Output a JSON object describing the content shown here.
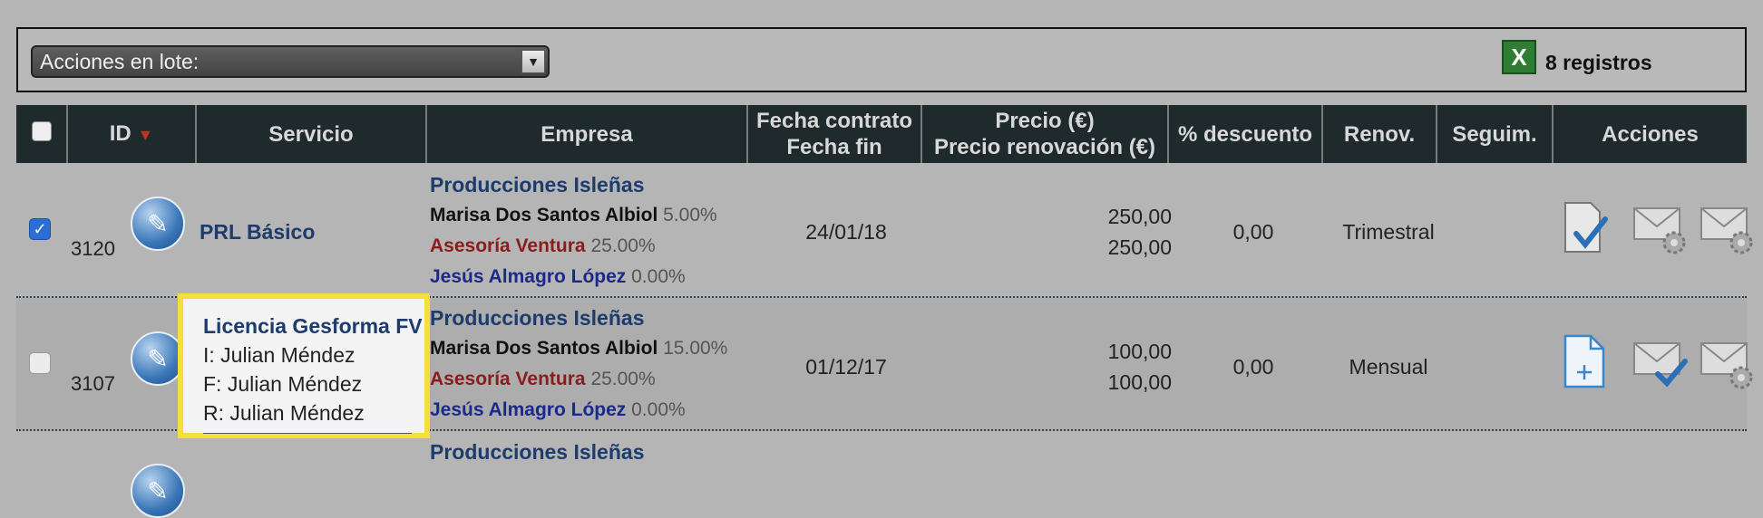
{
  "toolbar": {
    "batch_label": "Acciones en lote:",
    "records": "8 registros",
    "excel_glyph": "X"
  },
  "table": {
    "headers": {
      "id": "ID",
      "servicio": "Servicio",
      "empresa": "Empresa",
      "fecha_contrato": "Fecha contrato",
      "fecha_fin": "Fecha fin",
      "precio": "Precio (€)",
      "precio_renovacion": "Precio renovación (€)",
      "descuento": "% descuento",
      "renov": "Renov.",
      "seguim": "Seguim.",
      "acciones": "Acciones"
    },
    "rows": [
      {
        "checked": true,
        "id": "3120",
        "servicio": "PRL Básico",
        "empresa": "Producciones Isleñas",
        "persona1": "Marisa Dos Santos Albiol",
        "pct1": "5.00%",
        "persona2": "Asesoría Ventura",
        "pct2": "25.00%",
        "persona3": "Jesús Almagro López",
        "pct3": "0.00%",
        "fecha": "24/01/18",
        "precio": "250,00",
        "precio_renov": "250,00",
        "descuento": "0,00",
        "renov": "Trimestral"
      },
      {
        "checked": false,
        "id": "3107",
        "servicio": "",
        "empresa": "Producciones Isleñas",
        "persona1": "Marisa Dos Santos Albiol",
        "pct1": "15.00%",
        "persona2": "Asesoría Ventura",
        "pct2": "25.00%",
        "persona3": "Jesús Almagro López",
        "pct3": "0.00%",
        "fecha": "01/12/17",
        "precio": "100,00",
        "precio_renov": "100,00",
        "descuento": "0,00",
        "renov": "Mensual"
      },
      {
        "empresa": "Producciones Isleñas"
      }
    ]
  },
  "tooltip": {
    "title": "Licencia Gesforma FV",
    "line_i": "I: Julian Méndez",
    "line_f": "F: Julian Méndez",
    "line_r": "R: Julian Méndez"
  },
  "colors": {
    "header_bg": "#1e2a2c",
    "link_blue": "#1e3c6b",
    "red_name": "#8b1c1c",
    "tooltip_border": "#f5e03a"
  }
}
